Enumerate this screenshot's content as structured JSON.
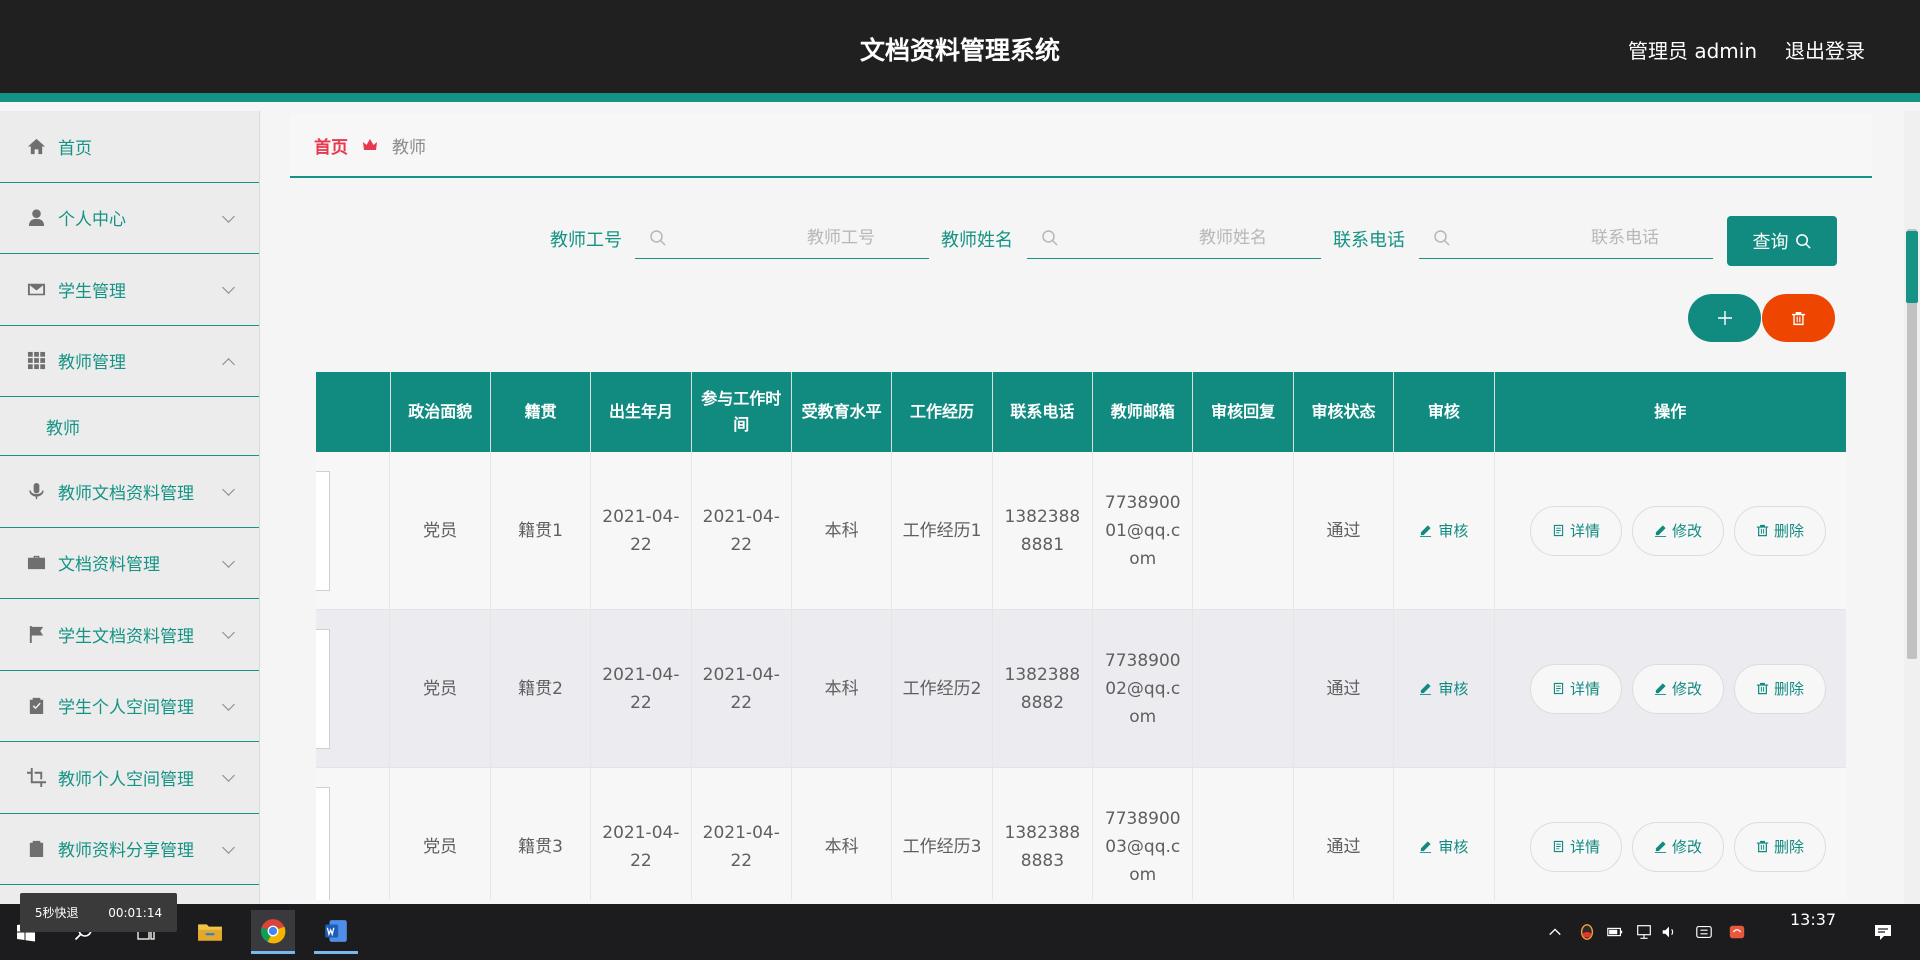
{
  "header": {
    "title": "文档资料管理系统",
    "user": "管理员 admin",
    "logout": "退出登录"
  },
  "sidebar": {
    "items": [
      {
        "label": "首页",
        "icon": "home-icon"
      },
      {
        "label": "个人中心",
        "icon": "user-icon"
      },
      {
        "label": "学生管理",
        "icon": "mail-icon"
      },
      {
        "label": "教师管理",
        "icon": "grid-icon"
      },
      {
        "label": "教师文档资料管理",
        "icon": "microphone-icon"
      },
      {
        "label": "文档资料管理",
        "icon": "briefcase-icon"
      },
      {
        "label": "学生文档资料管理",
        "icon": "flag-icon"
      },
      {
        "label": "学生个人空间管理",
        "icon": "clipboard-check-icon"
      },
      {
        "label": "教师个人空间管理",
        "icon": "crop-icon"
      },
      {
        "label": "教师资料分享管理",
        "icon": "clipboard-x-icon"
      }
    ],
    "submenu": {
      "label": "教师"
    }
  },
  "breadcrumb": {
    "home": "首页",
    "current": "教师"
  },
  "search": {
    "fields": [
      {
        "label": "教师工号",
        "placeholder": "教师工号"
      },
      {
        "label": "教师姓名",
        "placeholder": "教师姓名"
      },
      {
        "label": "联系电话",
        "placeholder": "联系电话"
      }
    ],
    "query_label": "查询"
  },
  "table": {
    "headers": [
      "",
      "政治面貌",
      "籍贯",
      "出生年月",
      "参与工作时间",
      "受教育水平",
      "工作经历",
      "联系电话",
      "教师邮箱",
      "审核回复",
      "审核状态",
      "审核",
      "操作"
    ],
    "audit_label": "审核",
    "detail_label": "详情",
    "edit_label": "修改",
    "delete_label": "删除",
    "rows": [
      {
        "politics": "党员",
        "origin": "籍贯1",
        "birth": "2021-04-22",
        "work_start": "2021-04-22",
        "education": "本科",
        "experience": "工作经历1",
        "phone": "13823888881",
        "email": "773890001@qq.com",
        "reply": "",
        "status": "通过"
      },
      {
        "politics": "党员",
        "origin": "籍贯2",
        "birth": "2021-04-22",
        "work_start": "2021-04-22",
        "education": "本科",
        "experience": "工作经历2",
        "phone": "13823888882",
        "email": "773890002@qq.com",
        "reply": "",
        "status": "通过"
      },
      {
        "politics": "党员",
        "origin": "籍贯3",
        "birth": "2021-04-22",
        "work_start": "2021-04-22",
        "education": "本科",
        "experience": "工作经历3",
        "phone": "13823888883",
        "email": "773890003@qq.com",
        "reply": "",
        "status": "通过"
      }
    ]
  },
  "overlay": {
    "left": "5秒快退",
    "right": "00:01:14"
  },
  "taskbar": {
    "clock": "13:37"
  }
}
